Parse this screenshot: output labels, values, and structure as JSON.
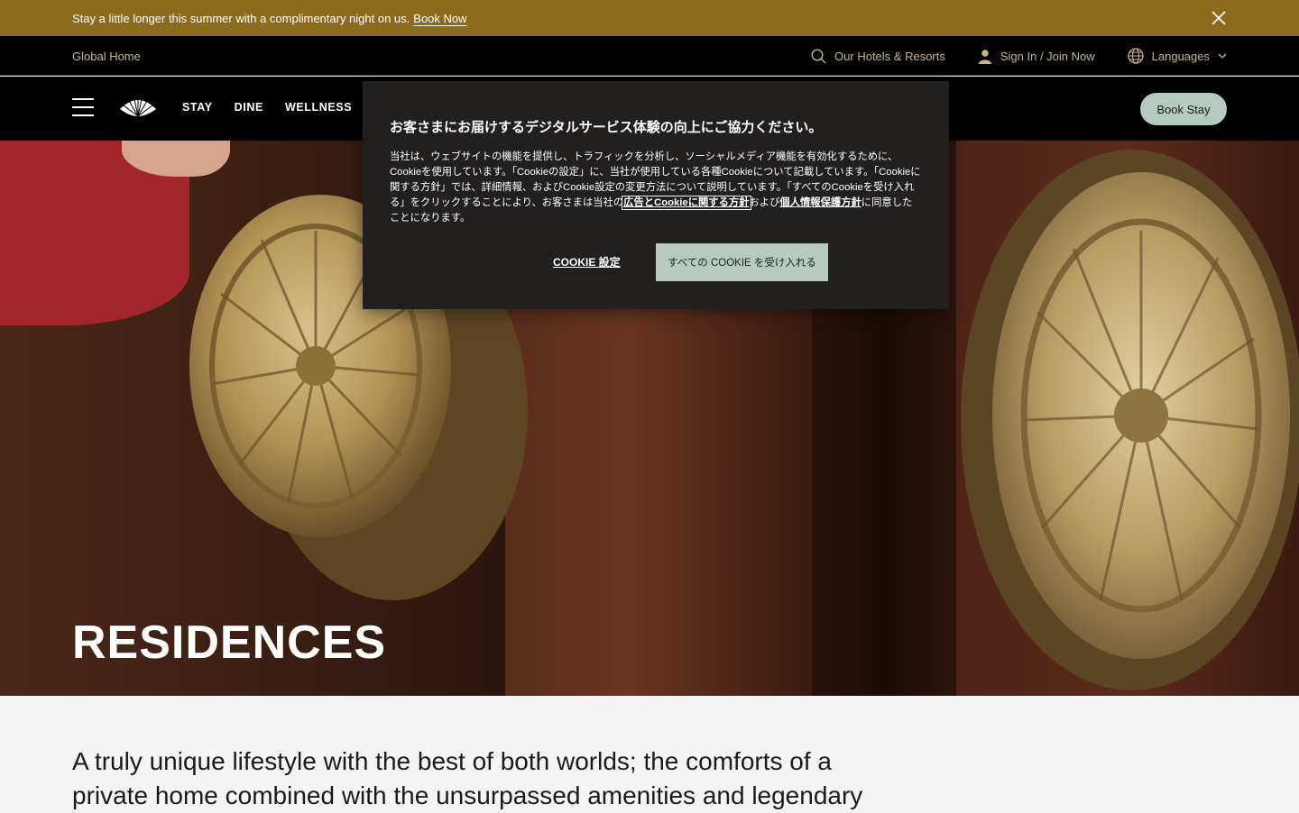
{
  "promo": {
    "text": "Stay a little longer this summer with a complimentary night on us.",
    "link": "Book Now"
  },
  "utility": {
    "global_home": "Global Home",
    "hotels": "Our Hotels & Resorts",
    "signin": "Sign In / Join Now",
    "languages": "Languages"
  },
  "nav": {
    "links": [
      "STAY",
      "DINE",
      "WELLNESS"
    ],
    "book": "Book Stay"
  },
  "hero": {
    "title": "RESIDENCES"
  },
  "cookie": {
    "heading": "お客さまにお届けするデジタルサービス体験の向上にご協力ください。",
    "body_1": "当社は、ウェブサイトの機能を提供し、トラフィックを分析し、ソーシャルメディア機能を有効化するために、Cookieを使用しています。「Cookieの設定」に、当社が使用している各種Cookieについて記載しています。「Cookieに関する方針」では、詳細情報、およびCookie設定の変更方法について説明しています。「すべてのCookieを受け入れる」をクリックすることにより、お客さまは当社の",
    "link_1": "広告とCookieに関する方針",
    "and": "および",
    "link_2": "個人情報保護方針",
    "body_2": "に同意したことになります。",
    "settings_button": "COOKIE 設定",
    "accept_button": "すべての COOKIE を受け入れる"
  },
  "intro": {
    "text": "A truly unique lifestyle with the best of both worlds; the comforts of a private home combined with the unsurpassed amenities and legendary"
  },
  "colors": {
    "promo_bg": "#8c6b1c",
    "accent_gold": "#c9b48a",
    "button_sage": "#b6cbbf",
    "modal_bg": "#221f1f"
  }
}
